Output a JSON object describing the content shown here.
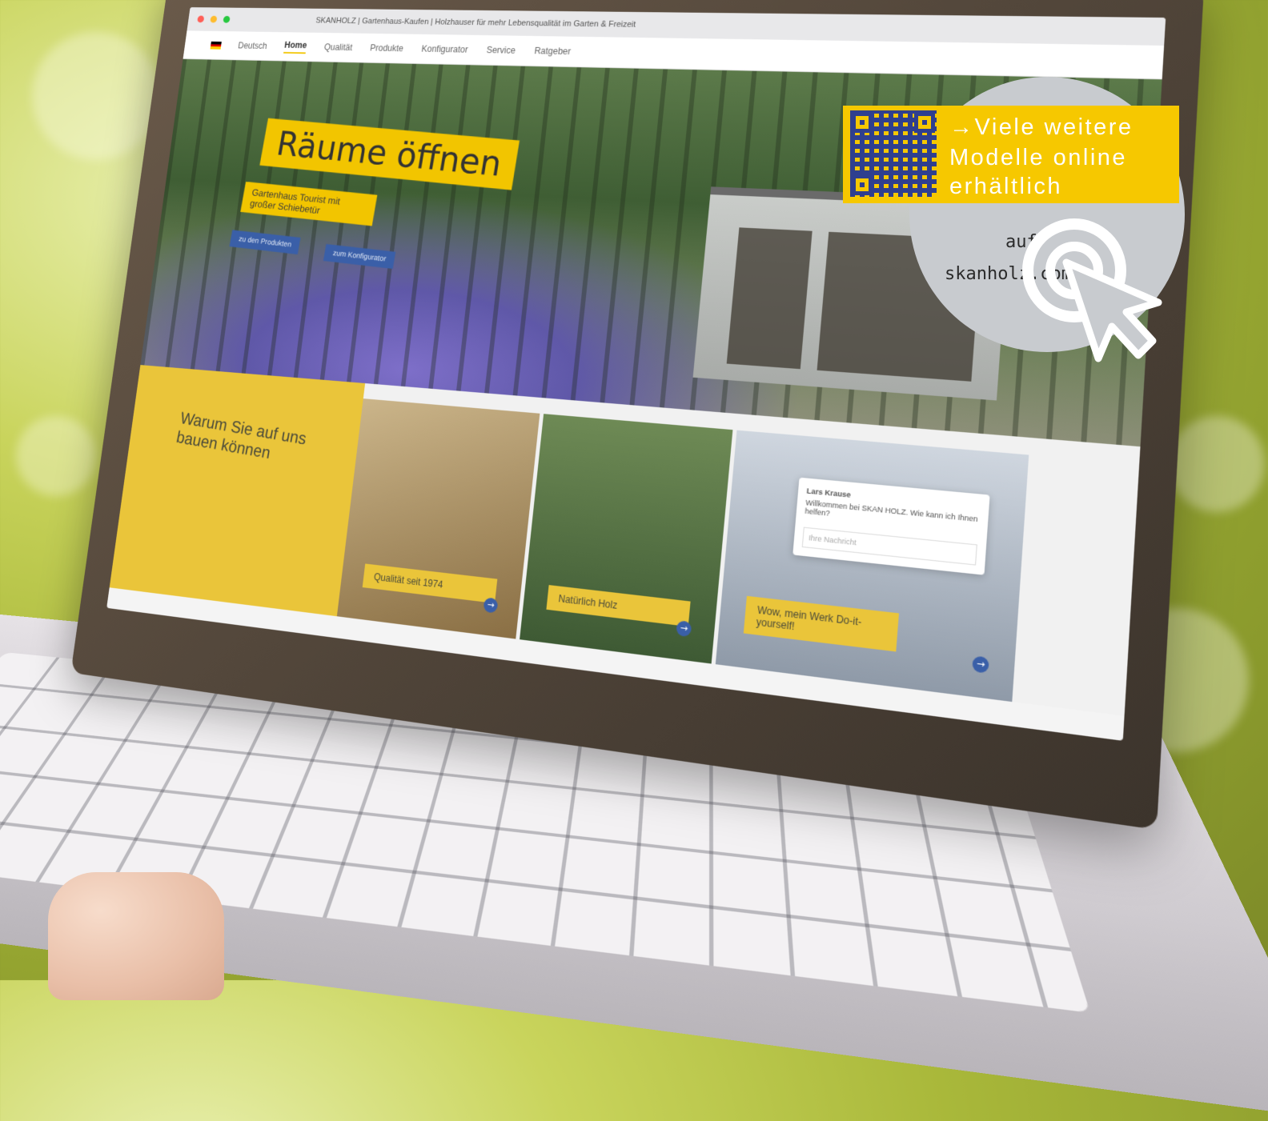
{
  "browser": {
    "tab_title": "SKANHOLZ | Gartenhaus-Kaufen | Holzhauser für mehr Lebensqualität im Garten & Freizeit",
    "address": "skanholz.com"
  },
  "nav": {
    "region": "Deutsch",
    "items": [
      "Home",
      "Qualität",
      "Produkte",
      "Konfigurator",
      "Service",
      "Ratgeber"
    ],
    "active": "Home"
  },
  "hero": {
    "title": "Räume öffnen",
    "subtitle": "Gartenhaus Tourist mit großer Schiebetür",
    "button_primary": "zu den Produkten",
    "button_secondary": "zum Konfigurator"
  },
  "why": {
    "heading": "Warum Sie auf uns bauen können"
  },
  "tiles": [
    {
      "label": "Qualität seit 1974"
    },
    {
      "label": "Natürlich Holz"
    },
    {
      "label": "Wow, mein Werk Do-it-yourself!"
    }
  ],
  "chat": {
    "agent": "Lars Krause",
    "message": "Willkommen bei SKAN HOLZ. Wie kann ich Ihnen helfen?",
    "input_placeholder": "Ihre Nachricht"
  },
  "promo": {
    "line1": "→Viele weitere",
    "line2": "Modelle online",
    "line3": "erhältlich",
    "auf": "auf",
    "url": "skanholz.com"
  },
  "colors": {
    "brand_yellow": "#f6c800",
    "brand_blue": "#2f3f8f",
    "circle_grey": "#c8cbcf"
  },
  "icons": {
    "qr": "qr-code-icon",
    "cursor": "target-cursor-icon"
  }
}
